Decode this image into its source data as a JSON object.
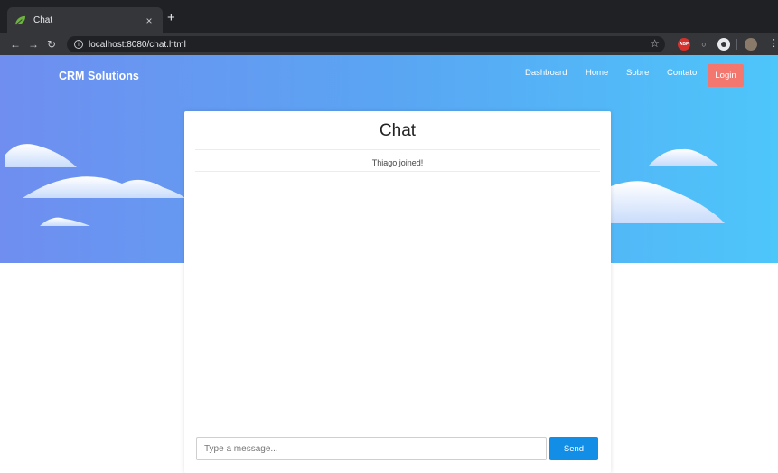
{
  "browser": {
    "tab": {
      "title": "Chat",
      "close_glyph": "×",
      "favicon": "leaf-icon"
    },
    "new_tab_glyph": "+",
    "address": "localhost:8080/chat.html",
    "extensions": {
      "abp_label": "ABP"
    }
  },
  "site": {
    "brand": "CRM Solutions",
    "nav": [
      {
        "label": "Dashboard"
      },
      {
        "label": "Home"
      },
      {
        "label": "Sobre"
      },
      {
        "label": "Contato"
      }
    ],
    "login_label": "Login"
  },
  "chat": {
    "title": "Chat",
    "messages": [
      {
        "text": "Thiago joined!"
      }
    ],
    "input_placeholder": "Type a message...",
    "input_value": "",
    "send_label": "Send"
  },
  "colors": {
    "hero_start": "#6f8ef0",
    "hero_end": "#4dc6fa",
    "login_bg": "#f4776f",
    "send_bg": "#128ee6"
  }
}
